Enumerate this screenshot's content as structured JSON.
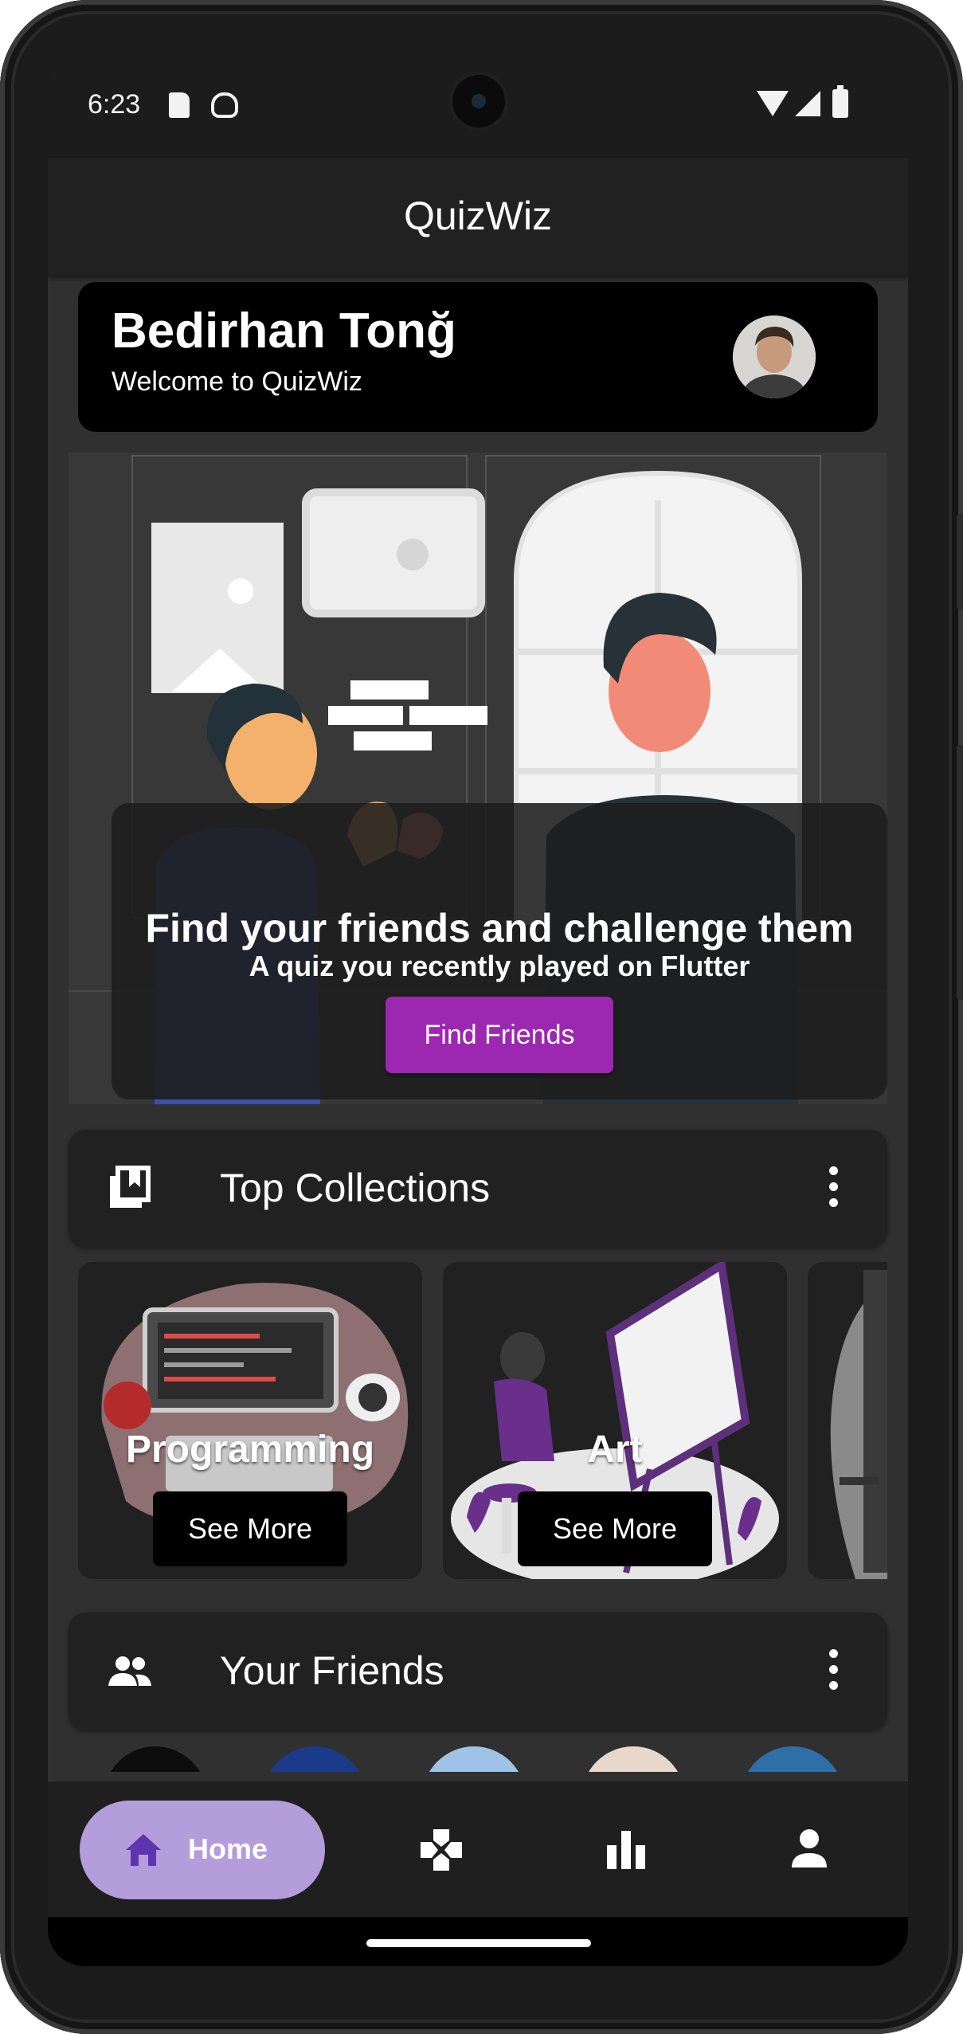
{
  "status_bar": {
    "time": "6:23",
    "icons": [
      "sd-card-icon",
      "android-icon",
      "wifi-icon",
      "signal-icon",
      "battery-icon"
    ]
  },
  "app_bar": {
    "title": "QuizWiz"
  },
  "user_card": {
    "name": "Bedirhan Tonğ",
    "welcome": "Welcome to QuizWiz"
  },
  "hero": {
    "title": "Find your friends and challenge them",
    "subtitle": "A quiz you recently played on Flutter",
    "button_label": "Find Friends"
  },
  "top_collections": {
    "title": "Top Collections",
    "icon": "bookmarks-icon",
    "items": [
      {
        "title": "Programming",
        "button_label": "See More"
      },
      {
        "title": "Art",
        "button_label": "See More"
      }
    ]
  },
  "your_friends": {
    "title": "Your Friends",
    "icon": "people-icon"
  },
  "bottom_nav": {
    "home_label": "Home",
    "items": [
      "home-icon",
      "games-icon",
      "leaderboard-icon",
      "profile-icon"
    ]
  },
  "colors": {
    "accent_purple": "#9c27b0",
    "nav_active": "#b39ddb",
    "surface": "#212121",
    "background": "#303030"
  }
}
